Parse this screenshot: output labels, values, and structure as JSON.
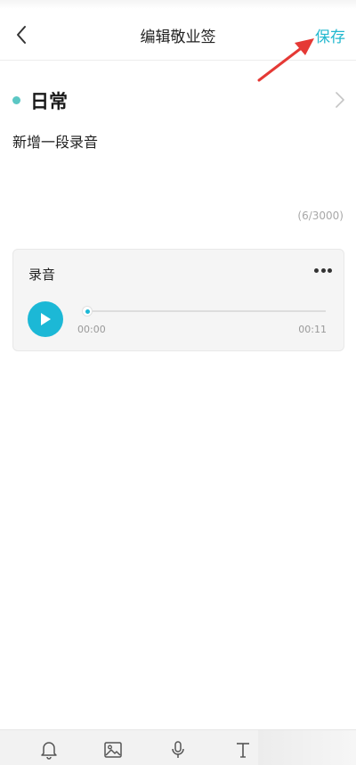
{
  "header": {
    "title": "编辑敬业签",
    "save_label": "保存"
  },
  "category": {
    "label": "日常",
    "dot_color": "#5bc7c4"
  },
  "note": {
    "text": "新增一段录音",
    "char_count": "(6/3000)"
  },
  "audio": {
    "title": "录音",
    "time_current": "00:00",
    "time_total": "00:11",
    "progress": 0.02
  },
  "toolbar": {
    "items": [
      "bell-icon",
      "image-icon",
      "microphone-icon",
      "text-icon"
    ]
  },
  "colors": {
    "accent": "#1cb8d6",
    "save": "#22b8cf",
    "annotation_arrow": "#e53935"
  }
}
